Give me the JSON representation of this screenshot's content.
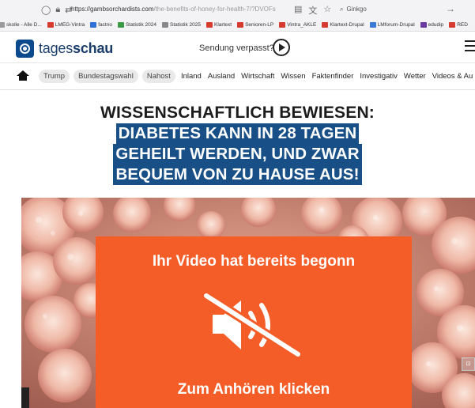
{
  "browser": {
    "url_host": "https://gambsorchardists.com",
    "url_path": "/the-benefits-of-honey-for-health-7/?DVOFs",
    "search_text": "Ginkgo",
    "bookmarks": [
      {
        "label": "skolle - Alle D...",
        "color": "#9a9a9a"
      },
      {
        "label": "LMEG-Vintra",
        "color": "#d63b2f"
      },
      {
        "label": "factno",
        "color": "#2f6fd6"
      },
      {
        "label": "Statistik 2024",
        "color": "#3a9a45"
      },
      {
        "label": "Statistik 2025",
        "color": "#888888"
      },
      {
        "label": "Klartext",
        "color": "#d63b2f"
      },
      {
        "label": "Senioren-LP",
        "color": "#d63b2f"
      },
      {
        "label": "Vintra_AKLE",
        "color": "#d63b2f"
      },
      {
        "label": "Klartext-Drupal",
        "color": "#d63b2f"
      },
      {
        "label": "LMforum-Drupal",
        "color": "#3a7ad6"
      },
      {
        "label": "edudip",
        "color": "#6a3aa0"
      },
      {
        "label": "RED",
        "color": "#d63b2f"
      }
    ]
  },
  "header": {
    "logo_light": "tages",
    "logo_bold": "schau",
    "missed_text": "Sendung verpasst?"
  },
  "nav": {
    "tags": [
      "Trump",
      "Bundestagswahl",
      "Nahost"
    ],
    "items": [
      "Inland",
      "Ausland",
      "Wirtschaft",
      "Wissen",
      "Faktenfinder",
      "Investigativ",
      "Wetter",
      "Videos & Au"
    ]
  },
  "headline": {
    "line1": "WISSENSCHAFTLICH BEWIESEN:",
    "line2": "DIABETES KANN IN 28 TAGEN",
    "line3": "GEHEILT WERDEN, UND ZWAR",
    "line4": "BEQUEM VON ZU HAUSE AUS!"
  },
  "video": {
    "overlay_title": "Ihr Video hat bereits begonn",
    "overlay_cta": "Zum Anhören klicken",
    "side_control": "⊡"
  },
  "colors": {
    "headline_highlight": "#184f86",
    "overlay": "#f55d28",
    "logo": "#0a4a8c"
  }
}
